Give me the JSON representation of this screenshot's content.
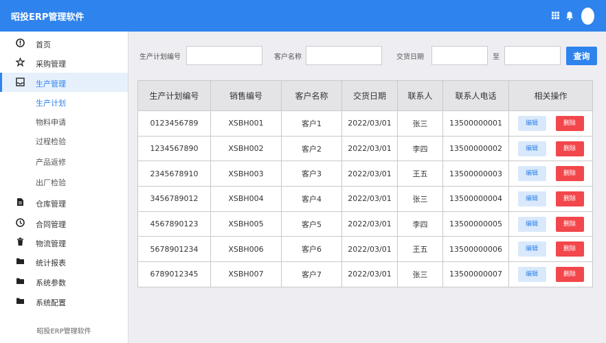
{
  "header": {
    "app_title": "昭投ERP管理软件"
  },
  "sidebar": {
    "items": [
      {
        "label": "首页",
        "icon": "alert-circle-icon"
      },
      {
        "label": "采购管理",
        "icon": "star-icon"
      },
      {
        "label": "生产管理",
        "icon": "inbox-icon",
        "active": true
      },
      {
        "label": "仓库管理",
        "icon": "document-icon"
      },
      {
        "label": "合同管理",
        "icon": "clock-icon"
      },
      {
        "label": "物流管理",
        "icon": "trash-icon"
      },
      {
        "label": "统计报表",
        "icon": "folder-icon"
      },
      {
        "label": "系统参数",
        "icon": "folder-icon"
      },
      {
        "label": "系统配置",
        "icon": "folder-icon"
      }
    ],
    "subitems": [
      {
        "label": "生产计划",
        "current": true
      },
      {
        "label": "物料申请"
      },
      {
        "label": "过程检验"
      },
      {
        "label": "产品返修"
      },
      {
        "label": "出厂检验"
      }
    ],
    "footer": "昭投ERP管理软件"
  },
  "filters": {
    "plan_no_label": "生产计划编号",
    "plan_no_value": "",
    "customer_label": "客户名称",
    "customer_value": "",
    "date_label": "交货日期",
    "date_from": "",
    "date_to_label": "至",
    "date_to": "",
    "query_label": "查询"
  },
  "table": {
    "columns": [
      "生产计划编号",
      "销售编号",
      "客户名称",
      "交货日期",
      "联系人",
      "联系人电话",
      "相关操作"
    ],
    "edit_label": "编辑",
    "delete_label": "删除",
    "rows": [
      [
        "0123456789",
        "XSBH001",
        "客户1",
        "2022/03/01",
        "张三",
        "13500000001"
      ],
      [
        "1234567890",
        "XSBH002",
        "客户2",
        "2022/03/01",
        "李四",
        "13500000002"
      ],
      [
        "2345678910",
        "XSBH003",
        "客户3",
        "2022/03/01",
        "王五",
        "13500000003"
      ],
      [
        "3456789012",
        "XSBH004",
        "客户4",
        "2022/03/01",
        "张三",
        "13500000004"
      ],
      [
        "4567890123",
        "XSBH005",
        "客户5",
        "2022/03/01",
        "李四",
        "13500000005"
      ],
      [
        "5678901234",
        "XSBH006",
        "客户6",
        "2022/03/01",
        "王五",
        "13500000006"
      ],
      [
        "6789012345",
        "XSBH007",
        "客户7",
        "2022/03/01",
        "张三",
        "13500000007"
      ]
    ]
  },
  "colors": {
    "primary": "#2f83ec",
    "danger": "#f2474c",
    "edit_bg": "#d9e9fb"
  }
}
